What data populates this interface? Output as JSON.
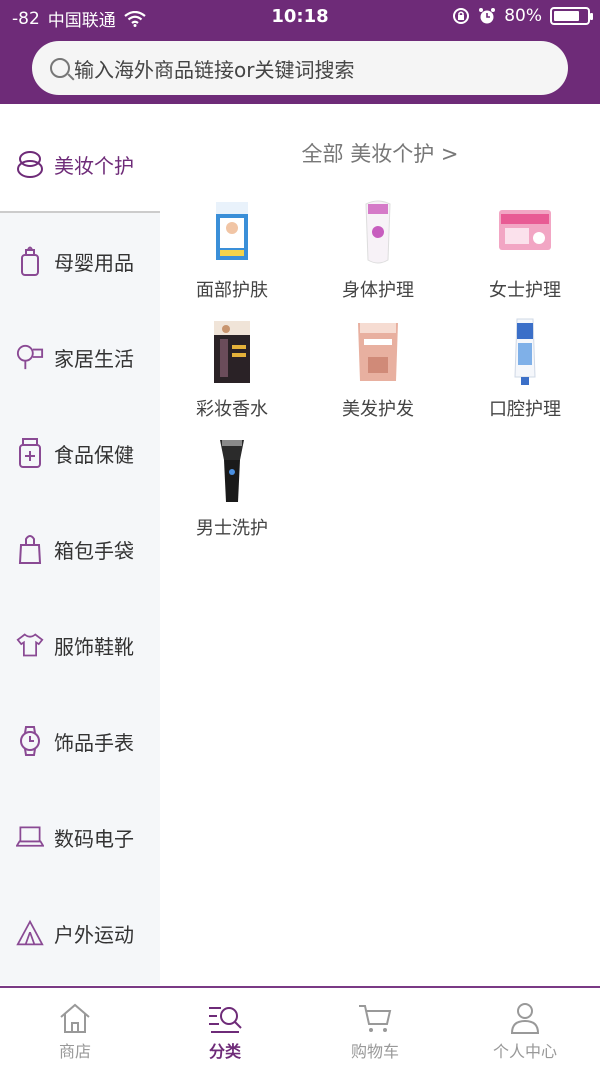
{
  "status": {
    "signal": "-82",
    "carrier": "中国联通",
    "time": "10:18",
    "battery": "80%",
    "battery_level": 0.8
  },
  "search": {
    "placeholder": "输入海外商品链接or关键词搜索"
  },
  "sidebar": {
    "items": [
      {
        "label": "美妆个护",
        "icon": "cosmetics-icon",
        "active": true
      },
      {
        "label": "母婴用品",
        "icon": "baby-bottle-icon",
        "active": false
      },
      {
        "label": "家居生活",
        "icon": "hair-dryer-icon",
        "active": false
      },
      {
        "label": "食品保健",
        "icon": "health-jar-icon",
        "active": false
      },
      {
        "label": "箱包手袋",
        "icon": "handbag-icon",
        "active": false
      },
      {
        "label": "服饰鞋靴",
        "icon": "tshirt-icon",
        "active": false
      },
      {
        "label": "饰品手表",
        "icon": "watch-icon",
        "active": false
      },
      {
        "label": "数码电子",
        "icon": "laptop-icon",
        "active": false
      },
      {
        "label": "户外运动",
        "icon": "tent-icon",
        "active": false
      }
    ]
  },
  "main": {
    "title": "全部 美妆个护 >",
    "categories": [
      {
        "label": "面部护肤"
      },
      {
        "label": "身体护理"
      },
      {
        "label": "女士护理"
      },
      {
        "label": "彩妆香水"
      },
      {
        "label": "美发护发"
      },
      {
        "label": "口腔护理"
      },
      {
        "label": "男士洗护"
      }
    ]
  },
  "tabbar": {
    "tabs": [
      {
        "label": "商店",
        "icon": "home-icon",
        "active": false
      },
      {
        "label": "分类",
        "icon": "category-search-icon",
        "active": true
      },
      {
        "label": "购物车",
        "icon": "cart-icon",
        "active": false
      },
      {
        "label": "个人中心",
        "icon": "person-icon",
        "active": false
      }
    ]
  },
  "colors": {
    "brand": "#6e2b78",
    "sidebar_bg": "#f5f7f9"
  }
}
